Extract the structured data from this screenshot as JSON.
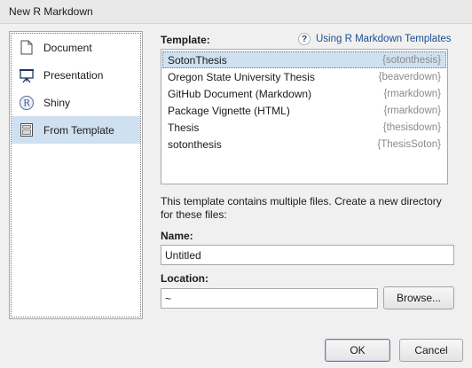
{
  "window": {
    "title": "New R Markdown"
  },
  "sidebar": {
    "items": [
      {
        "label": "Document",
        "icon": "document-icon",
        "selected": false
      },
      {
        "label": "Presentation",
        "icon": "presentation-icon",
        "selected": false
      },
      {
        "label": "Shiny",
        "icon": "shiny-icon",
        "selected": false
      },
      {
        "label": "From Template",
        "icon": "template-icon",
        "selected": true
      }
    ]
  },
  "template": {
    "label": "Template:",
    "help_link": "Using R Markdown Templates",
    "help_icon": "question-circle-icon",
    "items": [
      {
        "name": "SotonThesis",
        "package": "{sotonthesis}",
        "selected": true
      },
      {
        "name": "Oregon State University Thesis",
        "package": "{beaverdown}",
        "selected": false
      },
      {
        "name": "GitHub Document (Markdown)",
        "package": "{rmarkdown}",
        "selected": false
      },
      {
        "name": "Package Vignette (HTML)",
        "package": "{rmarkdown}",
        "selected": false
      },
      {
        "name": "Thesis",
        "package": "{thesisdown}",
        "selected": false
      },
      {
        "name": "sotonthesis",
        "package": "{ThesisSoton}",
        "selected": false
      }
    ]
  },
  "description": "This template contains multiple files. Create a new directory for these files:",
  "name_field": {
    "label": "Name:",
    "value": "Untitled"
  },
  "location_field": {
    "label": "Location:",
    "value": "~",
    "browse_label": "Browse..."
  },
  "buttons": {
    "ok": "OK",
    "cancel": "Cancel"
  },
  "colors": {
    "selection": "#cfe0f0",
    "link": "#1d4f94",
    "package_text": "#8a8a8a"
  }
}
